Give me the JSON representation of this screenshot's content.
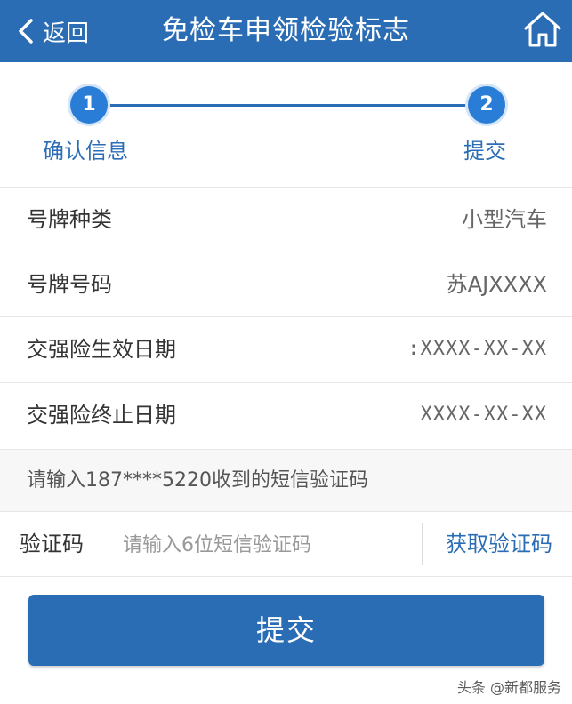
{
  "header": {
    "back_label": "返回",
    "title": "免检车申领检验标志",
    "home_icon": "home-icon",
    "back_icon": "chevron-left-icon"
  },
  "steps": [
    {
      "number": "1",
      "label": "确认信息"
    },
    {
      "number": "2",
      "label": "提交"
    }
  ],
  "fields": [
    {
      "label": "号牌种类",
      "value": "小型汽车"
    },
    {
      "label": "号牌号码",
      "value": "苏AJXXXX"
    },
    {
      "label": "交强险生效日期",
      "value": ":XXXX-XX-XX"
    },
    {
      "label": "交强险终止日期",
      "value": "XXXX-XX-XX"
    }
  ],
  "sms_hint": "请输入187****5220收到的短信验证码",
  "verification": {
    "label": "验证码",
    "placeholder": "请输入6位短信验证码",
    "value": "",
    "get_code_label": "获取验证码"
  },
  "submit_label": "提交",
  "watermark": "头条 @新都服务",
  "colors": {
    "primary": "#2a6db5",
    "step_circle": "#2a7dd6"
  }
}
